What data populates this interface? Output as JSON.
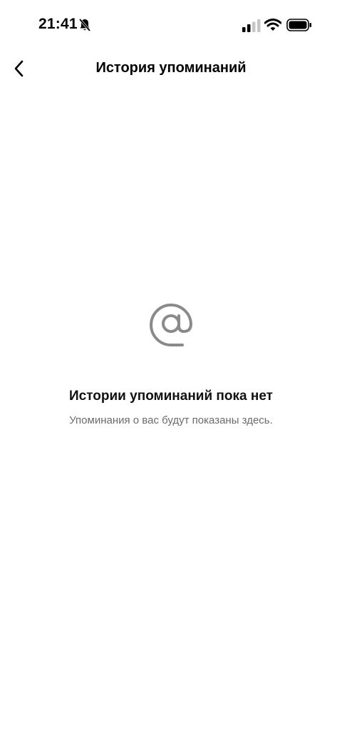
{
  "status_bar": {
    "time": "21:41",
    "icons": [
      "bell-muted-icon",
      "signal-icon",
      "wifi-icon",
      "battery-icon"
    ]
  },
  "nav": {
    "back_icon": "chevron-left-icon",
    "title": "История упоминаний"
  },
  "empty_state": {
    "icon": "at-sign-icon",
    "title": "Истории упоминаний пока нет",
    "subtitle": "Упоминания о вас будут показаны здесь."
  },
  "colors": {
    "background": "#ffffff",
    "text_primary": "#000000",
    "text_secondary": "#6b6b6b",
    "icon_gray": "#8a8a8a"
  }
}
